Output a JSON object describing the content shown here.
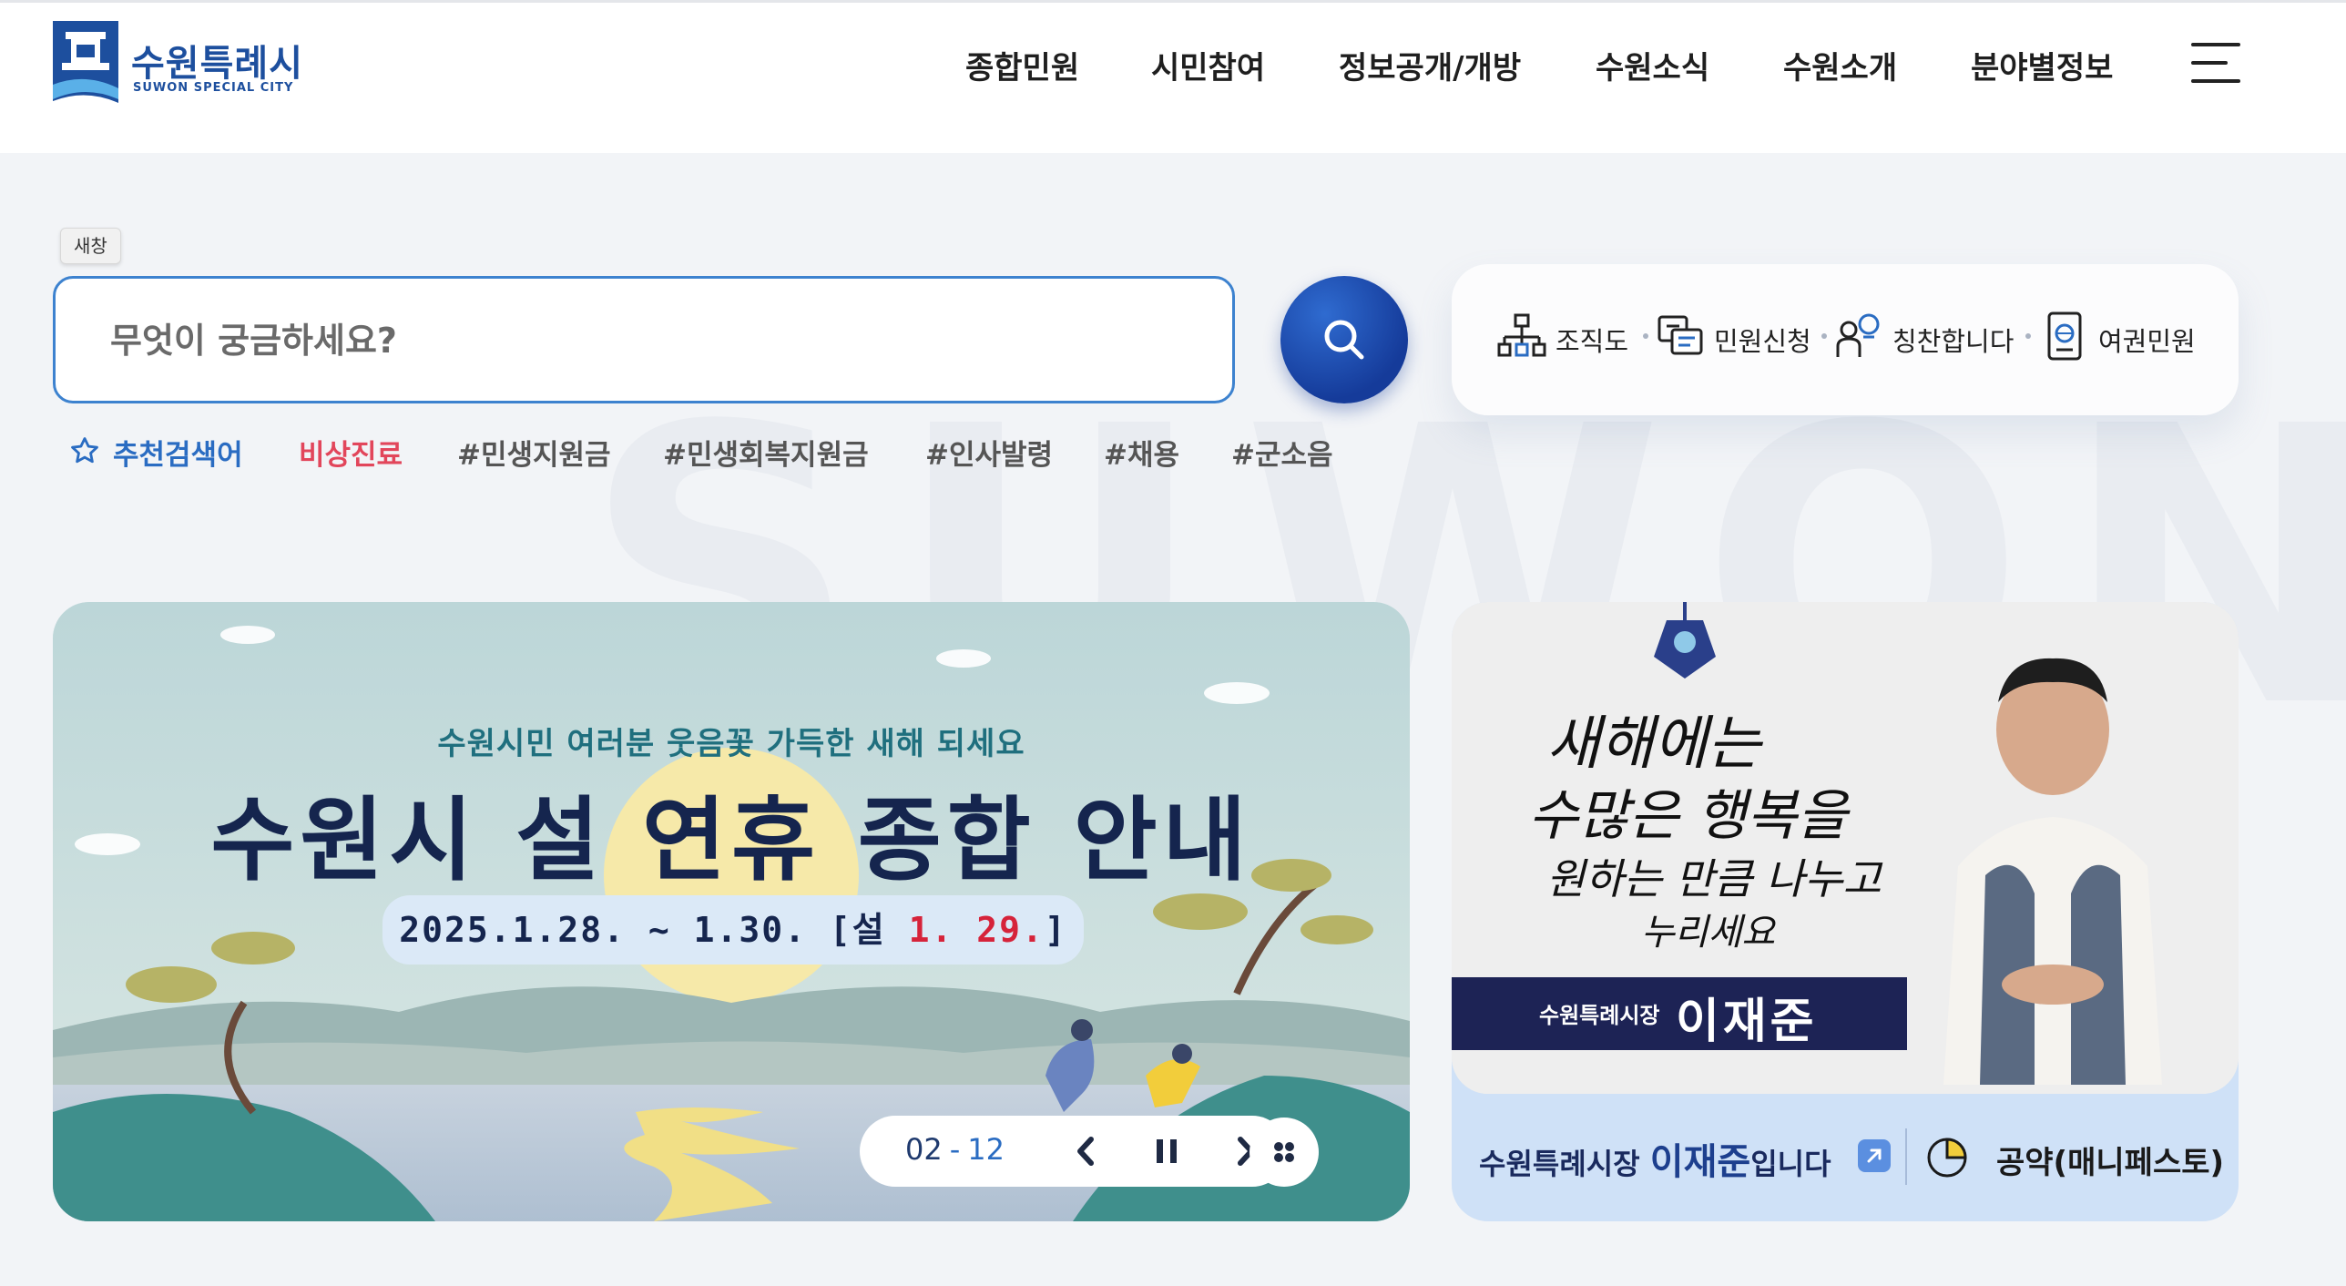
{
  "header": {
    "logo_ko": "수원특례시",
    "logo_en": "SUWON SPECIAL CITY",
    "nav": [
      "종합민원",
      "시민참여",
      "정보공개/개방",
      "수원소식",
      "수원소개",
      "분야별정보"
    ]
  },
  "watermark": "SUWON",
  "search": {
    "new_window_tip": "새창",
    "placeholder": "무엇이 궁금하세요?",
    "reco_label": "추천검색어",
    "tags": [
      "비상진료",
      "#민생지원금",
      "#민생회복지원금",
      "#인사발령",
      "#채용",
      "#군소음"
    ]
  },
  "quick_links": [
    "조직도",
    "민원신청",
    "칭찬합니다",
    "여권민원"
  ],
  "banner": {
    "subtitle": "수원시민 여러분 웃음꽃 가득한 새해 되세요",
    "title": "수원시 설 연휴 종합 안내",
    "date_prefix": "2025.1.28. ~ 1.30. [설 ",
    "date_highlight": "1. 29.",
    "date_suffix": "]",
    "current": "02",
    "separator": "-",
    "total": "12"
  },
  "mayor": {
    "calligraphy": [
      "새해에는",
      "수많은 행복을",
      "원하는 만큼 나누고",
      "누리세요"
    ],
    "bar_small": "수원특례시장",
    "bar_name": "이재준",
    "footer_prefix": "수원특례시장 ",
    "footer_name": "이재준",
    "footer_suffix": "입니다",
    "pledge": "공약(매니페스토)"
  },
  "colors": {
    "brand": "#1d4f9e",
    "accent": "#3d82cf",
    "hot_tag": "#e2465b"
  }
}
